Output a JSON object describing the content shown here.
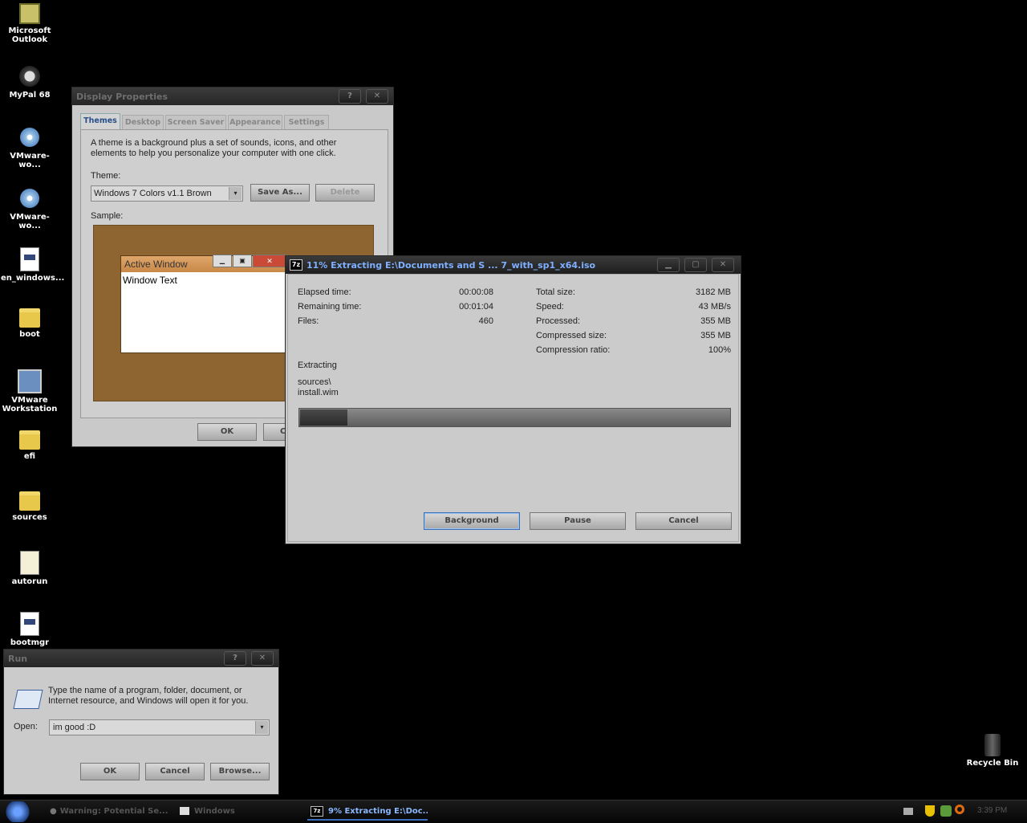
{
  "desktop": {
    "icons": [
      {
        "label_1": "Microsoft",
        "label_2": "Outlook"
      },
      {
        "label_1": "MyPal 68",
        "label_2": ""
      },
      {
        "label_1": "VMware-wo...",
        "label_2": ""
      },
      {
        "label_1": "VMware-wo...",
        "label_2": ""
      },
      {
        "label_1": "en_windows...",
        "label_2": ""
      },
      {
        "label_1": "boot",
        "label_2": ""
      },
      {
        "label_1": "VMware",
        "label_2": "Workstation"
      },
      {
        "label_1": "efi",
        "label_2": ""
      },
      {
        "label_1": "sources",
        "label_2": ""
      },
      {
        "label_1": "autorun",
        "label_2": ""
      },
      {
        "label_1": "bootmgr",
        "label_2": ""
      }
    ],
    "recycle_bin": "Recycle Bin"
  },
  "display_properties": {
    "title": "Display Properties",
    "tabs": [
      "Themes",
      "Desktop",
      "Screen Saver",
      "Appearance",
      "Settings"
    ],
    "description": "A theme is a background plus a set of sounds, icons, and other elements to help you personalize your computer with one click.",
    "theme_label": "Theme:",
    "theme_value": "Windows 7 Colors v1.1 Brown",
    "save_as": "Save As...",
    "delete": "Delete",
    "sample_label": "Sample:",
    "sample_window_title": "Active Window",
    "sample_window_text": "Window Text",
    "ok": "OK",
    "cancel_partial": "C"
  },
  "extract_dialog": {
    "title": "11% Extracting E:\\Documents and S ... 7_with_sp1_x64.iso",
    "app_icon": "7z",
    "left_stats": [
      {
        "label": "Elapsed time:",
        "value": "00:00:08"
      },
      {
        "label": "Remaining time:",
        "value": "00:01:04"
      },
      {
        "label": "Files:",
        "value": "460"
      }
    ],
    "right_stats": [
      {
        "label": "Total size:",
        "value": "3182 MB"
      },
      {
        "label": "Speed:",
        "value": "43 MB/s"
      },
      {
        "label": "Processed:",
        "value": "355 MB"
      },
      {
        "label": "Compressed size:",
        "value": "355 MB"
      },
      {
        "label": "Compression ratio:",
        "value": "100%"
      }
    ],
    "status": "Extracting",
    "path_1": "sources\\",
    "path_2": "install.wim",
    "progress": 0.11,
    "buttons": {
      "background": "Background",
      "pause": "Pause",
      "cancel": "Cancel"
    }
  },
  "run_dialog": {
    "title": "Run",
    "description": "Type the name of a program, folder, document, or Internet resource, and Windows will open it for you.",
    "open_label": "Open:",
    "open_value": "im good :D",
    "ok": "OK",
    "cancel": "Cancel",
    "browse": "Browse..."
  },
  "taskbar": {
    "tasks": [
      {
        "label": "Warning: Potential Se...",
        "active": false
      },
      {
        "label": "Windows",
        "active": false
      },
      {
        "label": "9% Extracting E:\\Doc...",
        "active": true
      }
    ],
    "clock": "3:39 PM"
  }
}
